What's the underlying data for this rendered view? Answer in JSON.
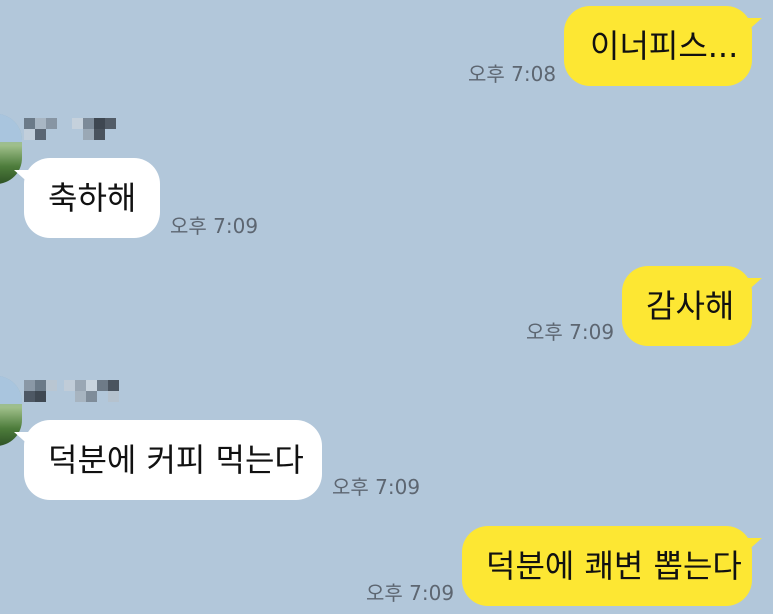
{
  "messages": [
    {
      "side": "me",
      "text": "이너피스...",
      "time": "오후 7:08"
    },
    {
      "side": "other",
      "text": "축하해",
      "time": "오후 7:09"
    },
    {
      "side": "me",
      "text": "감사해",
      "time": "오후 7:09"
    },
    {
      "side": "other",
      "text": "덕분에 커피 먹는다",
      "time": "오후 7:09"
    },
    {
      "side": "me",
      "text": "덕분에 쾌변 뽑는다",
      "time": "오후 7:09"
    }
  ],
  "colors": {
    "background": "#b2c7da",
    "my_bubble": "#fde733",
    "other_bubble": "#ffffff",
    "timestamp": "#5d6671"
  },
  "icons": {
    "avatar": "profile-photo",
    "sender_name": "pixelated-name"
  }
}
